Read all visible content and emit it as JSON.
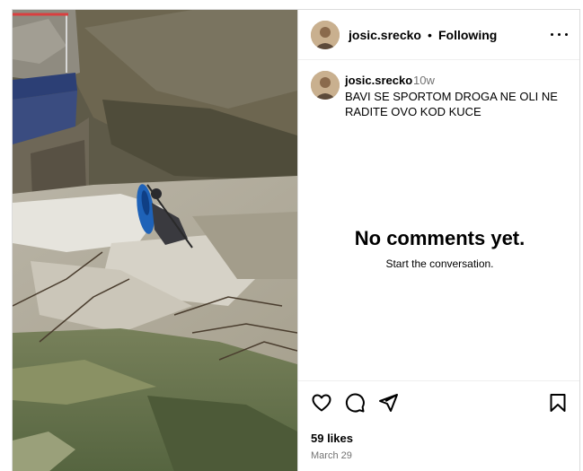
{
  "post": {
    "username": "josic.srecko",
    "separator": "•",
    "follow_status": "Following",
    "caption_username": "josic.srecko",
    "caption_time": "10w",
    "caption_text": "BAVI SE SPORTOM DROGA NE OLI NE RADITE OVO KOD KUCE",
    "likes": "59 likes",
    "date": "March 29"
  },
  "comments": {
    "empty_title": "No comments yet.",
    "empty_subtitle": "Start the conversation."
  },
  "icons": {
    "more": "more-options-icon",
    "like": "heart-icon",
    "comment": "comment-bubble-icon",
    "share": "paper-plane-icon",
    "save": "bookmark-icon"
  },
  "colors": {
    "border": "#dbdbdb",
    "secondary_text": "#737373",
    "kayak": "#1e62b8"
  }
}
